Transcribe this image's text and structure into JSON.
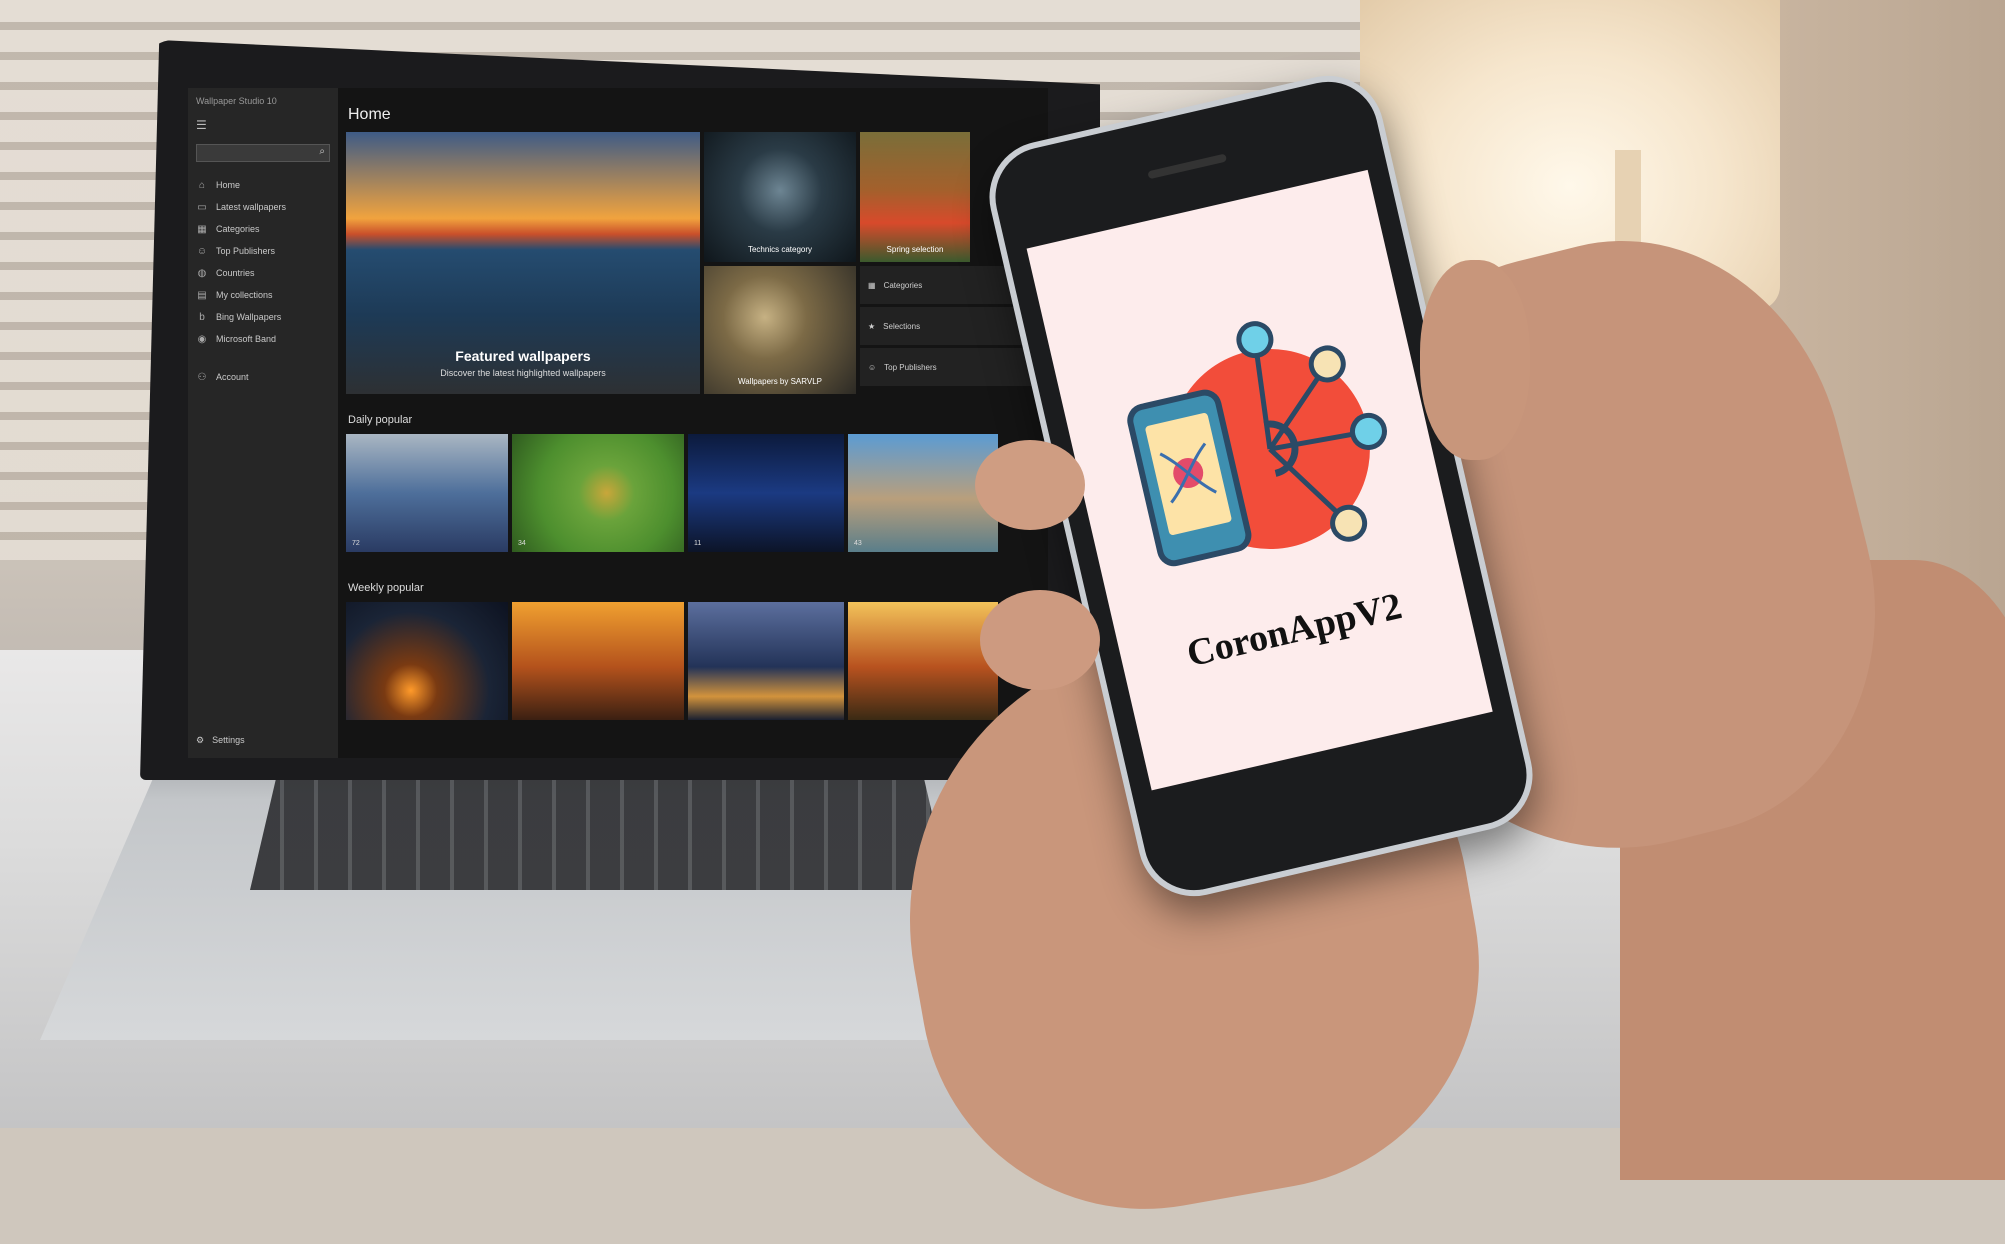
{
  "laptop_app": {
    "window_title": "Wallpaper Studio 10",
    "page_title": "Home",
    "nav": [
      {
        "label": "Home",
        "icon": "home-icon"
      },
      {
        "label": "Latest wallpapers",
        "icon": "image-icon"
      },
      {
        "label": "Categories",
        "icon": "grid-icon"
      },
      {
        "label": "Top Publishers",
        "icon": "people-icon"
      },
      {
        "label": "Countries",
        "icon": "globe-icon"
      },
      {
        "label": "My collections",
        "icon": "collection-icon"
      },
      {
        "label": "Bing Wallpapers",
        "icon": "bing-icon"
      },
      {
        "label": "Microsoft Band",
        "icon": "band-icon"
      },
      {
        "label": "Account",
        "icon": "account-icon"
      }
    ],
    "settings_label": "Settings",
    "featured": {
      "title": "Featured wallpapers",
      "subtitle": "Discover the latest highlighted wallpapers"
    },
    "tiles": {
      "technics": "Technics category",
      "spring": "Spring selection",
      "sarvlp": "Wallpapers by SARVLP"
    },
    "quick_links": [
      {
        "label": "Categories",
        "icon": "grid-icon"
      },
      {
        "label": "Selections",
        "icon": "star-icon"
      },
      {
        "label": "Top Publishers",
        "icon": "people-icon"
      }
    ],
    "sections": {
      "daily": "Daily popular",
      "weekly": "Weekly popular"
    },
    "daily_counts": [
      "72",
      "34",
      "11",
      "43"
    ]
  },
  "phone_app": {
    "name": "CoronAppV2",
    "colors": {
      "circle": "#f24d3a",
      "phone": "#3e8fb0",
      "screen": "#fde3a7",
      "node": "#6fd0e8",
      "node_alt": "#f7e3b4",
      "virus": "#e34b6a"
    }
  }
}
